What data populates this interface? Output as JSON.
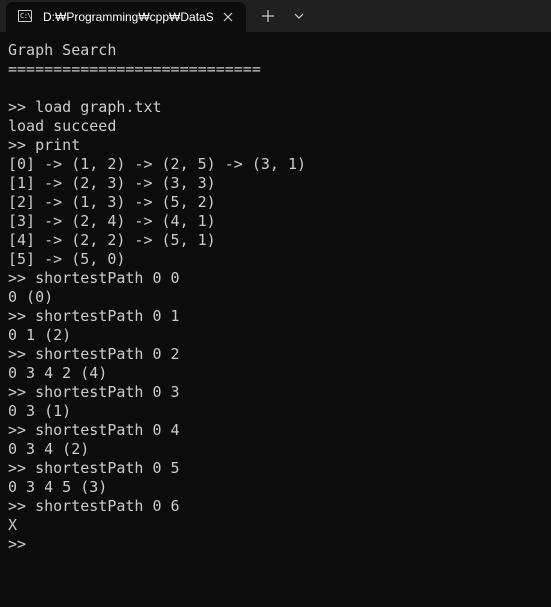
{
  "titlebar": {
    "tab": {
      "icon": "terminal-icon",
      "icon_glyph": "C:\\",
      "title": "D:₩Programming₩cpp₩DataS",
      "close_icon": "close-icon"
    },
    "new_tab_icon": "plus-icon",
    "dropdown_icon": "chevron-down-icon"
  },
  "terminal": {
    "lines": [
      "Graph Search",
      "============================",
      "",
      ">> load graph.txt",
      "load succeed",
      ">> print",
      "[0] -> (1, 2) -> (2, 5) -> (3, 1)",
      "[1] -> (2, 3) -> (3, 3)",
      "[2] -> (1, 3) -> (5, 2)",
      "[3] -> (2, 4) -> (4, 1)",
      "[4] -> (2, 2) -> (5, 1)",
      "[5] -> (5, 0)",
      ">> shortestPath 0 0",
      "0 (0)",
      ">> shortestPath 0 1",
      "0 1 (2)",
      ">> shortestPath 0 2",
      "0 3 4 2 (4)",
      ">> shortestPath 0 3",
      "0 3 (1)",
      ">> shortestPath 0 4",
      "0 3 4 (2)",
      ">> shortestPath 0 5",
      "0 3 4 5 (3)",
      ">> shortestPath 0 6",
      "X",
      ">>"
    ]
  },
  "colors": {
    "background": "#0c0c0c",
    "titlebar": "#202020",
    "text": "#cccccc",
    "tab_title": "#ffffff"
  }
}
